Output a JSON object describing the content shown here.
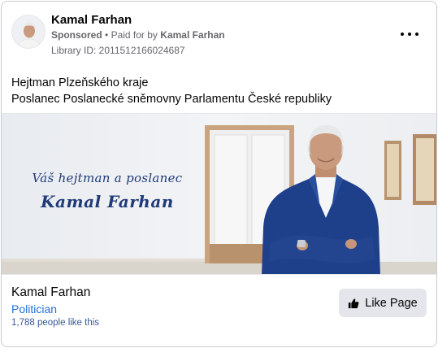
{
  "header": {
    "page_name": "Kamal Farhan",
    "sponsored_label": "Sponsored",
    "separator": "•",
    "paid_for_label": "Paid for by",
    "payer": "Kamal Farhan",
    "library_id": "Library ID: 2011512166024687",
    "more_icon": "more-horizontal-icon"
  },
  "body": {
    "line1": "Hejtman Plzeňského kraje",
    "line2": "Poslanec Poslanecké sněmovny Parlamentu České republiky"
  },
  "creative": {
    "tagline": "Váš hejtman a poslanec",
    "name": "Kamal Farhan"
  },
  "footer": {
    "name": "Kamal Farhan",
    "category": "Politician",
    "likes": "1,788 people like this",
    "like_button_label": "Like Page",
    "like_icon": "thumbs-up-icon"
  },
  "colors": {
    "link_blue": "#216fdb",
    "secondary_text": "#65676b",
    "button_bg": "#e4e6eb",
    "creative_text": "#1f3a78",
    "suit_blue": "#1e3f8a"
  }
}
